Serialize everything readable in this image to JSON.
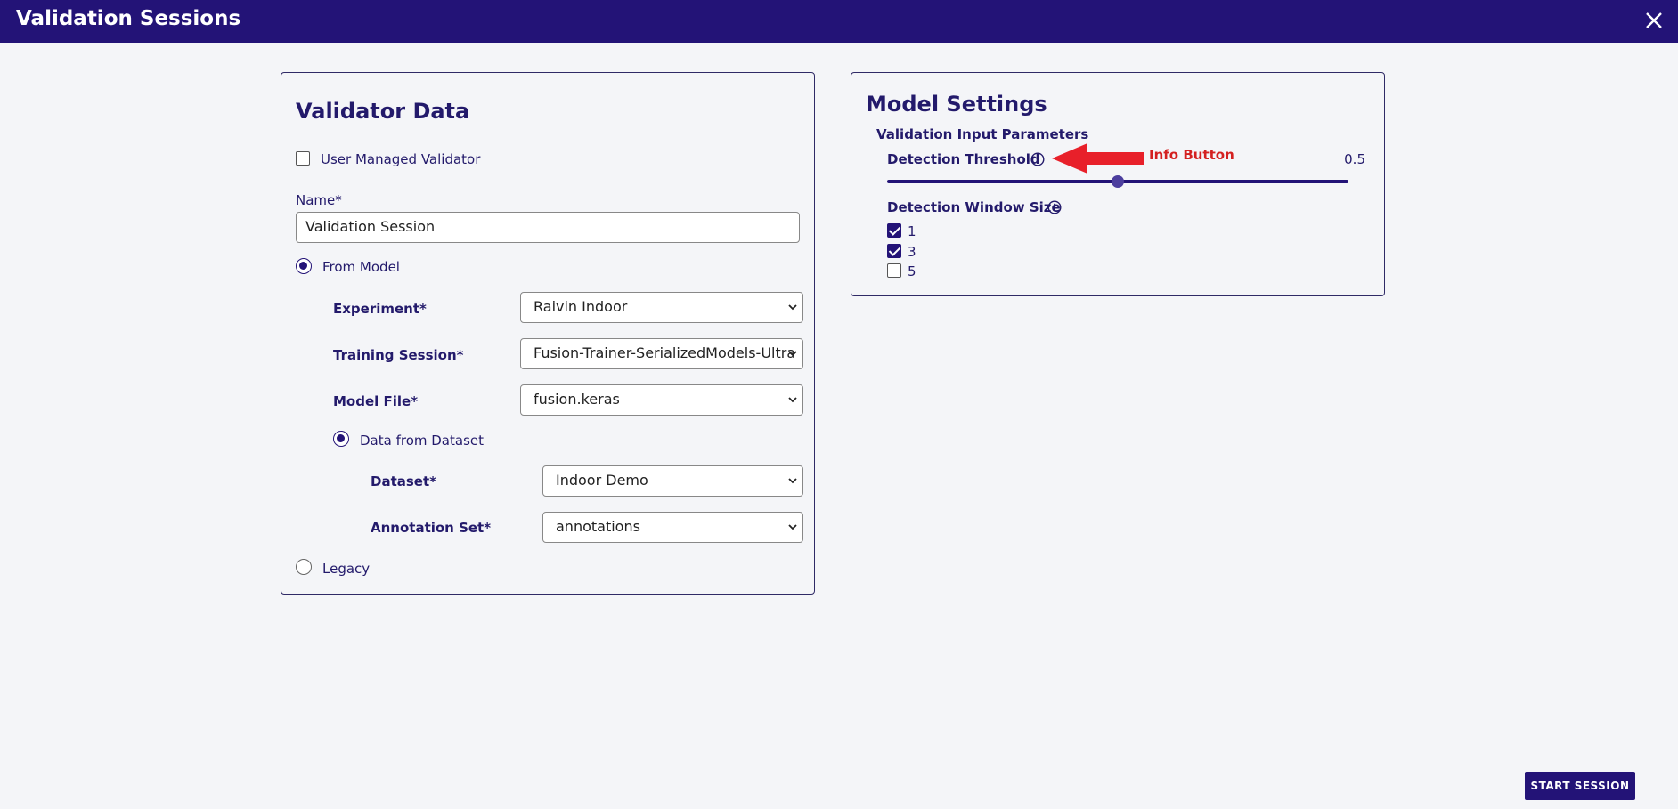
{
  "header": {
    "title": "Validation Sessions",
    "close_icon": "close-icon"
  },
  "validator_data": {
    "title": "Validator Data",
    "user_managed_label": "User Managed Validator",
    "user_managed_checked": false,
    "name_label": "Name*",
    "name_value": "Validation Session",
    "from_model_label": "From Model",
    "from_model_selected": true,
    "experiment_label": "Experiment*",
    "experiment_value": "Raivin Indoor",
    "training_session_label": "Training Session*",
    "training_session_value": "Fusion-Trainer-SerializedModels-Ultra",
    "model_file_label": "Model File*",
    "model_file_value": "fusion.keras",
    "data_from_dataset_label": "Data from Dataset",
    "data_from_dataset_selected": true,
    "dataset_label": "Dataset*",
    "dataset_value": "Indoor Demo",
    "annotation_set_label": "Annotation Set*",
    "annotation_set_value": "annotations",
    "legacy_label": "Legacy",
    "legacy_selected": false
  },
  "model_settings": {
    "title": "Model Settings",
    "section_label": "Validation Input Parameters",
    "detection_threshold_label": "Detection Threshold",
    "detection_threshold_value": "0.5",
    "detection_threshold_fraction": 0.5,
    "detection_window_label": "Detection Window Size",
    "window_options": [
      {
        "label": "1",
        "checked": true
      },
      {
        "label": "3",
        "checked": true
      },
      {
        "label": "5",
        "checked": false
      }
    ]
  },
  "annotation": {
    "text": "Info Button",
    "color": "#d42020"
  },
  "footer": {
    "start_label": "START SESSION"
  },
  "colors": {
    "primary": "#231377",
    "background": "#f4f5f8"
  }
}
